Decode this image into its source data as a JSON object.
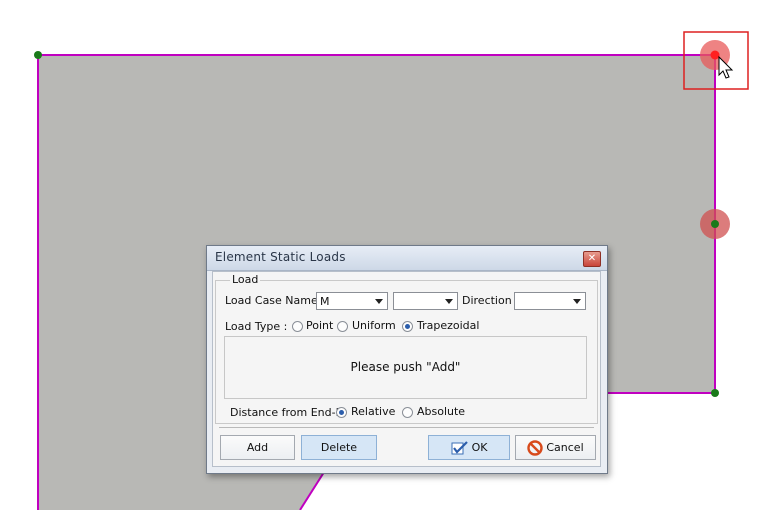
{
  "dialog": {
    "title": "Element Static Loads",
    "close_glyph": "✕",
    "group_label": "Load",
    "load_case_label": "Load Case Name :",
    "load_case_value": "M",
    "second_combo_value": "",
    "direction_label": "Direction :",
    "direction_value": "",
    "load_type_label": "Load Type :",
    "load_types": [
      "Point",
      "Uniform",
      "Trapezoidal"
    ],
    "load_type_selected": "Trapezoidal",
    "info_text": "Please push \"Add\"",
    "distance_label": "Distance from End-I",
    "distance_options": [
      "Relative",
      "Absolute"
    ],
    "distance_selected": "Relative",
    "buttons": {
      "add": "Add",
      "delete": "Delete",
      "ok": "OK",
      "cancel": "Cancel"
    }
  },
  "canvas": {
    "fill_color": "#b8b8b5",
    "edge_color": "#c000c0",
    "node_color": "#1a7a1a",
    "selected_node_color": "#ff2020",
    "highlight_box_color": "#dd2020"
  }
}
